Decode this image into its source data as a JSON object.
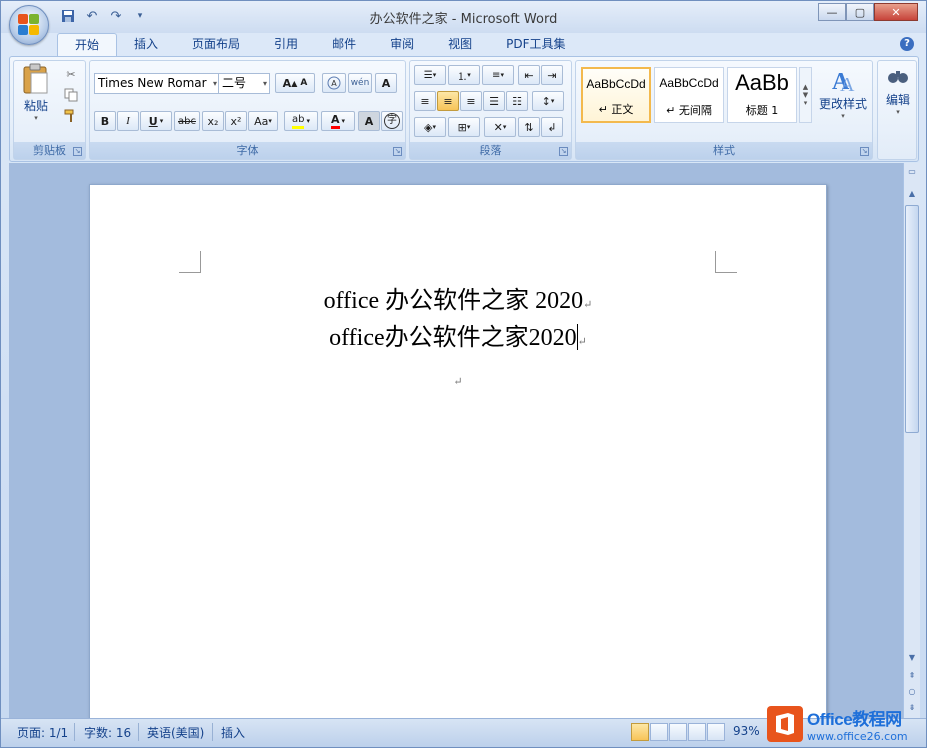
{
  "window": {
    "title": "办公软件之家 - Microsoft Word",
    "controls": {
      "minimize": "—",
      "maximize": "▢",
      "close": "✕"
    }
  },
  "quick_access": {
    "save": "save-icon",
    "undo": "undo-icon",
    "redo": "redo-icon",
    "customize": "customize-icon"
  },
  "tabs": [
    {
      "label": "开始",
      "active": true
    },
    {
      "label": "插入"
    },
    {
      "label": "页面布局"
    },
    {
      "label": "引用"
    },
    {
      "label": "邮件"
    },
    {
      "label": "审阅"
    },
    {
      "label": "视图"
    },
    {
      "label": "PDF工具集"
    }
  ],
  "ribbon": {
    "clipboard": {
      "label": "剪贴板",
      "paste_label": "粘贴"
    },
    "font": {
      "label": "字体",
      "font_name": "Times New Romar",
      "font_size": "二号",
      "buttons": {
        "grow": "A",
        "shrink": "A",
        "bold": "B",
        "italic": "I",
        "underline": "U",
        "strike": "abc",
        "subscript": "x₂",
        "superscript": "x²",
        "case": "Aa",
        "highlight": "ab",
        "color": "A",
        "shade": "A",
        "enclose": "字"
      }
    },
    "paragraph": {
      "label": "段落"
    },
    "styles": {
      "label": "样式",
      "items": [
        {
          "sample": "AaBbCcDd",
          "name": "↵ 正文",
          "active": true
        },
        {
          "sample": "AaBbCcDd",
          "name": "↵ 无间隔"
        },
        {
          "sample": "AaBb",
          "name": "标题 1"
        }
      ],
      "change_styles": "更改样式"
    },
    "editing": {
      "label": "编辑"
    }
  },
  "document": {
    "line1": "office 办公软件之家 2020",
    "line2": "office办公软件之家2020",
    "para_mark": "↵"
  },
  "status": {
    "page": "页面: 1/1",
    "words": "字数: 16",
    "language": "英语(美国)",
    "mode": "插入",
    "zoom": "93%"
  },
  "watermark": {
    "title": "Office教程网",
    "url": "www.office26.com"
  },
  "colors": {
    "ribbon_bg": "#e4eef9",
    "highlight_yellow": "#ffff00",
    "font_red": "#ff0000",
    "accent_blue": "#15428b",
    "watermark_orange": "#e8541c"
  }
}
